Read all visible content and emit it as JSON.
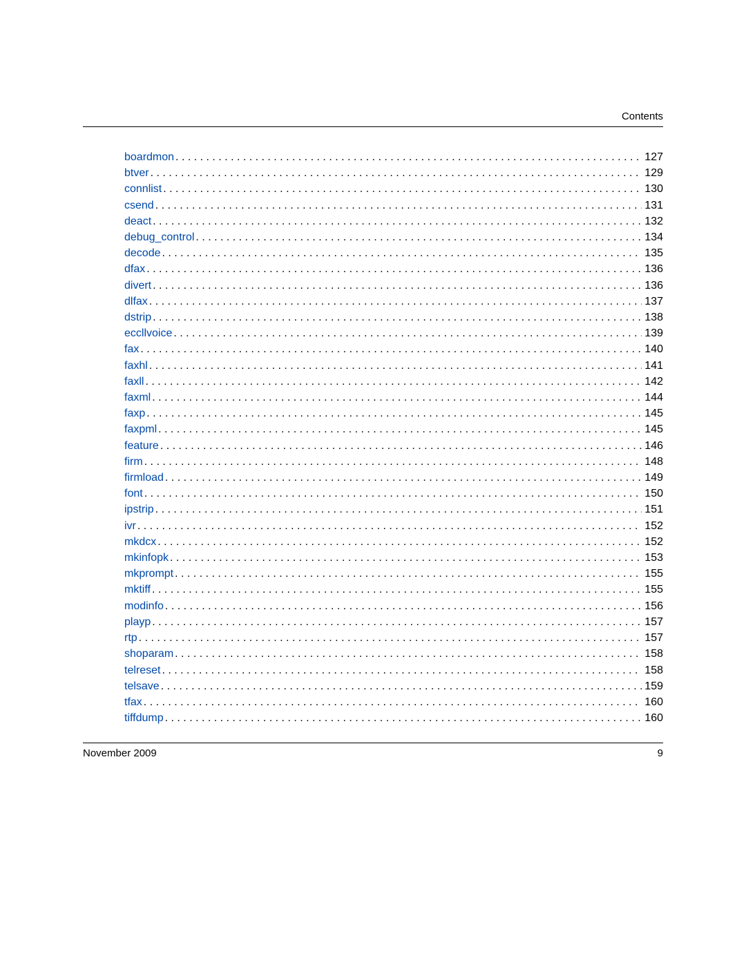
{
  "header": {
    "label": "Contents"
  },
  "toc": {
    "entries": [
      {
        "label": "boardmon",
        "page": "127"
      },
      {
        "label": "btver",
        "page": "129"
      },
      {
        "label": "connlist",
        "page": "130"
      },
      {
        "label": "csend",
        "page": "131"
      },
      {
        "label": "deact",
        "page": "132"
      },
      {
        "label": "debug_control",
        "page": "134"
      },
      {
        "label": "decode",
        "page": "135"
      },
      {
        "label": "dfax",
        "page": "136"
      },
      {
        "label": "divert",
        "page": "136"
      },
      {
        "label": "dlfax",
        "page": "137"
      },
      {
        "label": "dstrip",
        "page": "138"
      },
      {
        "label": "eccllvoice",
        "page": "139"
      },
      {
        "label": "fax",
        "page": "140"
      },
      {
        "label": "faxhl",
        "page": "141"
      },
      {
        "label": "faxll",
        "page": "142"
      },
      {
        "label": "faxml",
        "page": "144"
      },
      {
        "label": "faxp",
        "page": "145"
      },
      {
        "label": "faxpml",
        "page": "145"
      },
      {
        "label": "feature",
        "page": "146"
      },
      {
        "label": "firm",
        "page": "148"
      },
      {
        "label": "firmload",
        "page": "149"
      },
      {
        "label": "font",
        "page": "150"
      },
      {
        "label": "ipstrip",
        "page": "151"
      },
      {
        "label": "ivr",
        "page": "152"
      },
      {
        "label": "mkdcx",
        "page": "152"
      },
      {
        "label": "mkinfopk",
        "page": "153"
      },
      {
        "label": "mkprompt",
        "page": "155"
      },
      {
        "label": "mktiff",
        "page": "155"
      },
      {
        "label": "modinfo",
        "page": "156"
      },
      {
        "label": "playp",
        "page": "157"
      },
      {
        "label": "rtp",
        "page": "157"
      },
      {
        "label": "shoparam",
        "page": "158"
      },
      {
        "label": "telreset",
        "page": "158"
      },
      {
        "label": "telsave",
        "page": "159"
      },
      {
        "label": "tfax",
        "page": "160"
      },
      {
        "label": "tiffdump",
        "page": "160"
      }
    ]
  },
  "footer": {
    "date": "November 2009",
    "page_number": "9"
  }
}
